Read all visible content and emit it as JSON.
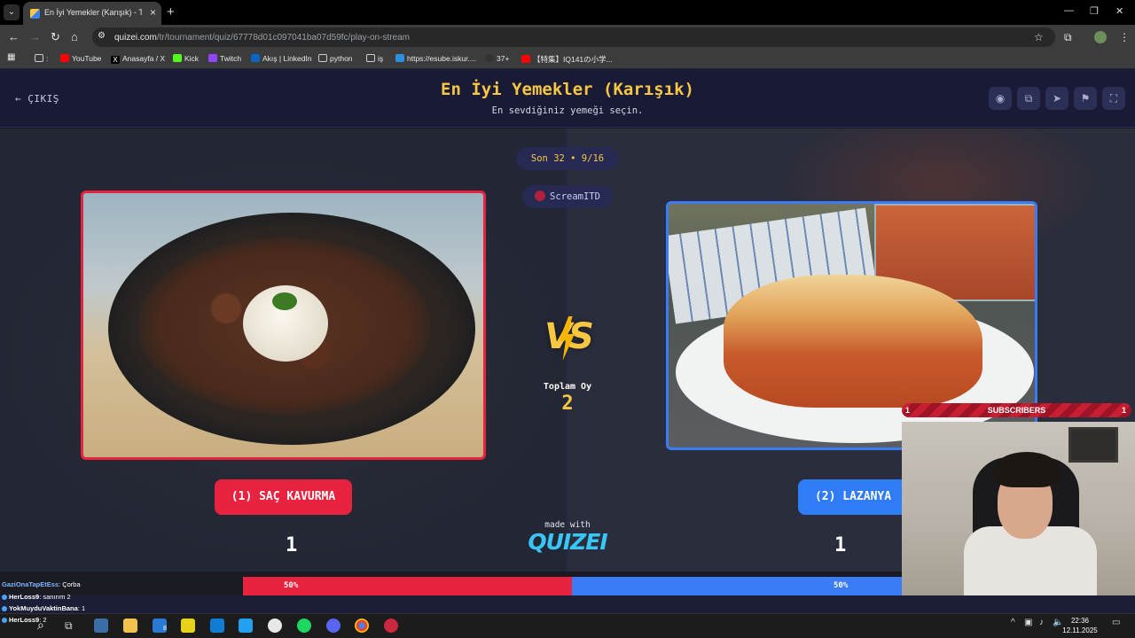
{
  "browser": {
    "tab_title": "En İyi Yemekler (Karışık) - Tier Li",
    "url_host": "quizei.com",
    "url_path": "/tr/tournament/quiz/67778d01c097041ba07d59fc/play-on-stream",
    "bookmarks": [
      "YouTube",
      "Anasayfa / X",
      "Kick",
      "Twitch",
      "Akış | LinkedIn",
      "python",
      "iş",
      "https://esube.iskur....",
      "37+",
      "【特集】IQ141の小学..."
    ]
  },
  "header": {
    "exit_label": "ÇIKIŞ",
    "title": "En İyi Yemekler (Karışık)",
    "subtitle": "En sevdiğiniz yemeği seçin."
  },
  "stage": {
    "round_label": "Son 32 • 9/16",
    "user": "ScreamITD",
    "vs": "VS",
    "total_label": "Toplam Oy",
    "total_votes": "2",
    "left": {
      "label": "(1) SAÇ KAVURMA",
      "votes": "1",
      "percent": "50%",
      "share": 0.5,
      "color": "#e8233f"
    },
    "right": {
      "label": "(2) LAZANYA",
      "votes": "1",
      "percent": "50%",
      "share": 0.5,
      "color": "#3b7bf5"
    },
    "made_with": "made with",
    "brand": "QUIZEI"
  },
  "chat": [
    {
      "name": "GaziOnaTapEtEss",
      "text": ": Çorba",
      "color": "#7fb3ff"
    },
    {
      "name": "HerLoss9",
      "text": ": sanırım 2",
      "color": "#ffffff"
    },
    {
      "name": "YokMuyduVaktinBana",
      "text": ": 1",
      "color": "#ffffff"
    },
    {
      "name": "HerLoss9",
      "text": ": 2",
      "color": "#ffffff"
    }
  ],
  "overlay": {
    "subscribers_label": "SUBSCRIBERS",
    "subscribers_left": "1",
    "subscribers_right": "1"
  },
  "taskbar": {
    "badge": "8",
    "time": "22:36",
    "date": "12.11.2025"
  }
}
